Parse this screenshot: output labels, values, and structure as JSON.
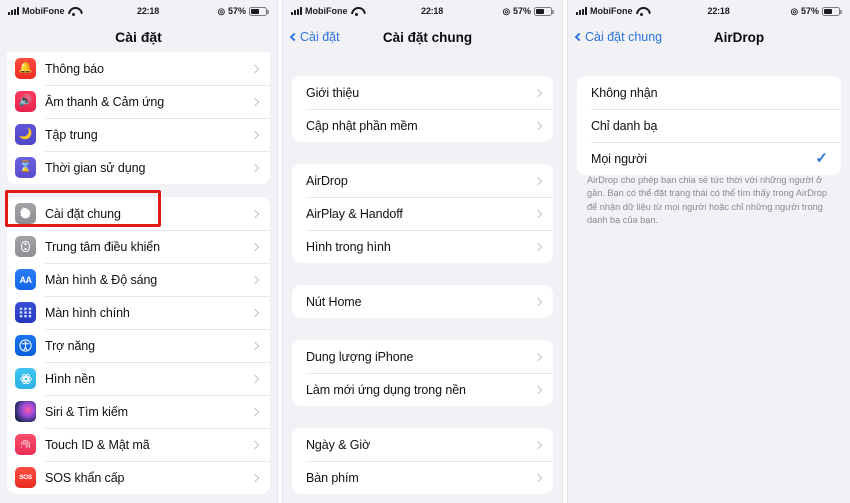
{
  "status_bar": {
    "carrier": "MobiFone",
    "time": "22:18",
    "battery_percent": "57%",
    "signal_icon": "cellular-signal-icon",
    "wifi_icon": "wifi-icon",
    "location_icon": "location-arrow-icon",
    "battery_icon": "battery-icon"
  },
  "colors": {
    "accent": "#2d74da",
    "highlight": "#e01b17",
    "page_bg": "#f2f2f6",
    "card_bg": "#ffffff",
    "separator": "#e9e9ec",
    "footnote_text": "#8a8a8e"
  },
  "panel1": {
    "nav_title": "Cài đặt",
    "groups": [
      {
        "rows": [
          {
            "label": "Thông báo",
            "icon": "bell-icon"
          },
          {
            "label": "Âm thanh & Cảm ứng",
            "icon": "speaker-icon"
          },
          {
            "label": "Tập trung",
            "icon": "moon-icon"
          },
          {
            "label": "Thời gian sử dụng",
            "icon": "hourglass-icon"
          }
        ]
      },
      {
        "rows": [
          {
            "label": "Cài đặt chung",
            "icon": "gear-icon"
          },
          {
            "label": "Trung tâm điều khiển",
            "icon": "control-center-icon"
          },
          {
            "label": "Màn hình & Độ sáng",
            "icon": "display-brightness-icon"
          },
          {
            "label": "Màn hình chính",
            "icon": "home-screen-icon"
          },
          {
            "label": "Trợ năng",
            "icon": "accessibility-icon"
          },
          {
            "label": "Hình nền",
            "icon": "wallpaper-icon"
          },
          {
            "label": "Siri & Tìm kiếm",
            "icon": "siri-icon"
          },
          {
            "label": "Touch ID & Mật mã",
            "icon": "fingerprint-icon"
          },
          {
            "label": "SOS khẩn cấp",
            "icon": "sos-icon"
          }
        ]
      }
    ],
    "highlight_label": "Cài đặt chung"
  },
  "panel2": {
    "back_label": "Cài đặt",
    "nav_title": "Cài đặt chung",
    "groups": [
      {
        "rows": [
          {
            "label": "Giới thiệu"
          },
          {
            "label": "Cập nhật phần mềm"
          }
        ]
      },
      {
        "rows": [
          {
            "label": "AirDrop"
          },
          {
            "label": "AirPlay & Handoff"
          },
          {
            "label": "Hình trong hình"
          }
        ]
      },
      {
        "rows": [
          {
            "label": "Nút Home"
          }
        ]
      },
      {
        "rows": [
          {
            "label": "Dung lượng iPhone"
          },
          {
            "label": "Làm mới ứng dụng trong nền"
          }
        ]
      },
      {
        "rows": [
          {
            "label": "Ngày & Giờ"
          },
          {
            "label": "Bàn phím"
          }
        ]
      }
    ],
    "highlight_label": "AirDrop"
  },
  "panel3": {
    "back_label": "Cài đặt chung",
    "nav_title": "AirDrop",
    "options": [
      {
        "label": "Không nhận",
        "selected": false
      },
      {
        "label": "Chỉ danh bạ",
        "selected": false
      },
      {
        "label": "Mọi người",
        "selected": true
      }
    ],
    "checkmark": "✓",
    "footnote": "AirDrop cho phép bạn chia sẻ tức thời với những người ở gần. Bạn có thể đặt trạng thái có thể tìm thấy trong AirDrop để nhận dữ liệu từ mọi người hoặc chỉ những người trong danh bạ của bạn.",
    "highlight_label": "Mọi người"
  }
}
